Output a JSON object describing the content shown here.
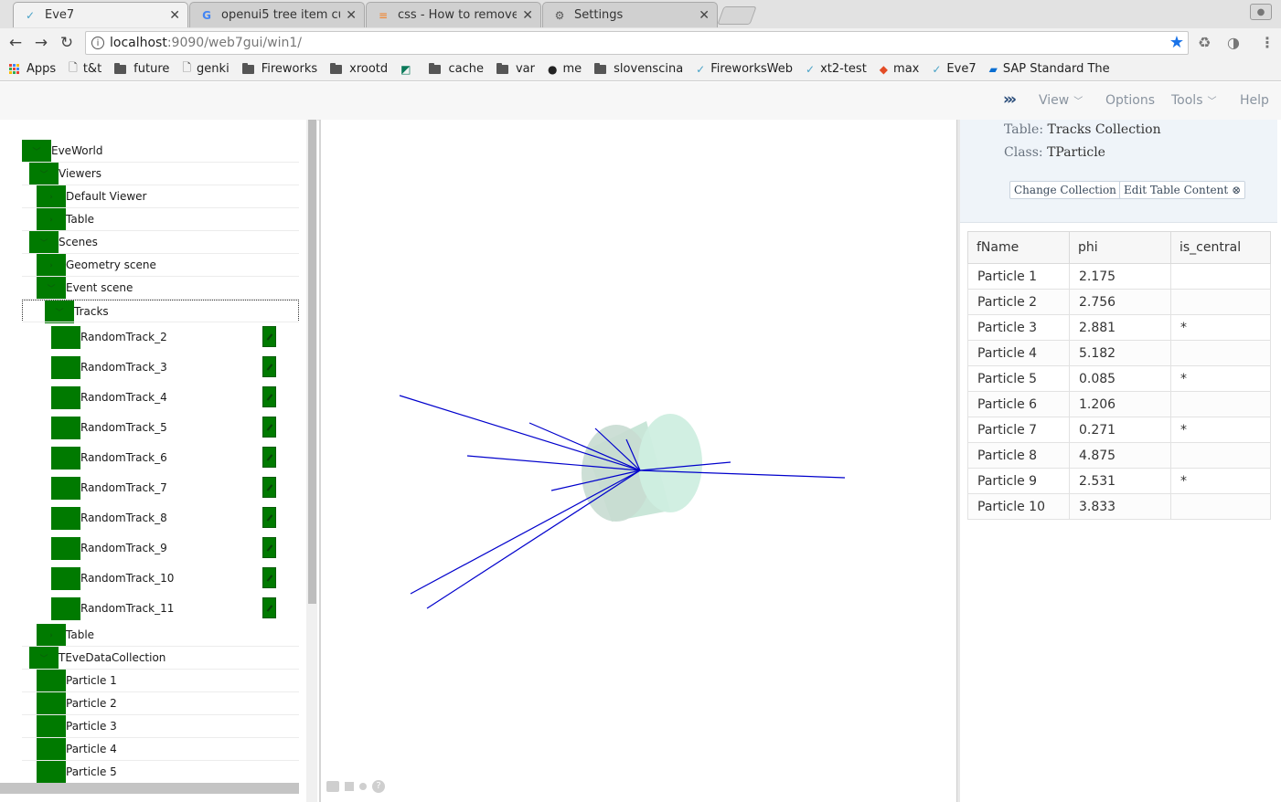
{
  "browser": {
    "tabs": [
      {
        "title": "Eve7",
        "icon": "fireworks-icon"
      },
      {
        "title": "openui5 tree item cu",
        "icon": "google-icon"
      },
      {
        "title": "css - How to remove",
        "icon": "stackoverflow-icon"
      },
      {
        "title": "Settings",
        "icon": "gear-icon"
      }
    ],
    "url_host": "localhost",
    "url_rest": ":9090/web7gui/win1/",
    "bookmarks": [
      {
        "label": "Apps",
        "icon": "apps-icon"
      },
      {
        "label": "t&t",
        "icon": "page-icon"
      },
      {
        "label": "future",
        "icon": "folder-icon"
      },
      {
        "label": "genki",
        "icon": "page-icon"
      },
      {
        "label": "Fireworks",
        "icon": "folder-icon"
      },
      {
        "label": "xrootd",
        "icon": "folder-icon"
      },
      {
        "label": "",
        "icon": "app-icon"
      },
      {
        "label": "cache",
        "icon": "folder-icon"
      },
      {
        "label": "var",
        "icon": "folder-icon"
      },
      {
        "label": "me",
        "icon": "github-icon"
      },
      {
        "label": "slovenscina",
        "icon": "folder-icon"
      },
      {
        "label": "FireworksWeb",
        "icon": "fireworks-icon"
      },
      {
        "label": "xt2-test",
        "icon": "fireworks-icon"
      },
      {
        "label": "max",
        "icon": "sd-icon"
      },
      {
        "label": "Eve7",
        "icon": "fireworks-icon"
      },
      {
        "label": "SAP Standard The",
        "icon": "sap-icon"
      }
    ]
  },
  "app": {
    "menu": {
      "view": "View",
      "options": "Options",
      "tools": "Tools",
      "help": "Help"
    }
  },
  "tree": {
    "rows": [
      {
        "label": "EveWorld",
        "level": 0,
        "toggle": "expanded"
      },
      {
        "label": "Viewers",
        "level": 1,
        "toggle": "expanded"
      },
      {
        "label": "Default Viewer",
        "level": 2,
        "toggle": "collapsed"
      },
      {
        "label": "Table",
        "level": 2,
        "toggle": "collapsed"
      },
      {
        "label": "Scenes",
        "level": 1,
        "toggle": "expanded"
      },
      {
        "label": "Geometry scene",
        "level": 2,
        "toggle": "collapsed"
      },
      {
        "label": "Event scene",
        "level": 2,
        "toggle": "expanded"
      },
      {
        "label": "Tracks",
        "level": 3,
        "toggle": "expanded",
        "selected": true
      }
    ],
    "tracks": [
      "RandomTrack_2",
      "RandomTrack_3",
      "RandomTrack_4",
      "RandomTrack_5",
      "RandomTrack_6",
      "RandomTrack_7",
      "RandomTrack_8",
      "RandomTrack_9",
      "RandomTrack_10",
      "RandomTrack_11"
    ],
    "after": [
      {
        "label": "Table",
        "level": 2,
        "toggle": "collapsed"
      },
      {
        "label": "TEveDataCollection",
        "level": 1,
        "toggle": "expanded"
      },
      {
        "label": "Particle 1",
        "level": 2,
        "toggle": "none"
      },
      {
        "label": "Particle 2",
        "level": 2,
        "toggle": "none"
      },
      {
        "label": "Particle 3",
        "level": 2,
        "toggle": "none"
      },
      {
        "label": "Particle 4",
        "level": 2,
        "toggle": "none"
      },
      {
        "label": "Particle 5",
        "level": 2,
        "toggle": "none"
      }
    ]
  },
  "viewer": {
    "track_color": "#0000cc",
    "cylinder_color": "#cfeee0"
  },
  "panel": {
    "table_key": "Table:",
    "table_value": "Tracks Collection",
    "class_key": "Class:",
    "class_value": "TParticle",
    "change_collection": "Change Collection",
    "edit_table": "Edit Table Content",
    "columns": [
      "fName",
      "phi",
      "is_central"
    ],
    "rows": [
      [
        "Particle 1",
        "2.175",
        ""
      ],
      [
        "Particle 2",
        "2.756",
        ""
      ],
      [
        "Particle 3",
        "2.881",
        "*"
      ],
      [
        "Particle 4",
        "5.182",
        ""
      ],
      [
        "Particle 5",
        "0.085",
        "*"
      ],
      [
        "Particle 6",
        "1.206",
        ""
      ],
      [
        "Particle 7",
        "0.271",
        "*"
      ],
      [
        "Particle 8",
        "4.875",
        ""
      ],
      [
        "Particle 9",
        "2.531",
        "*"
      ],
      [
        "Particle 10",
        "3.833",
        ""
      ]
    ]
  }
}
